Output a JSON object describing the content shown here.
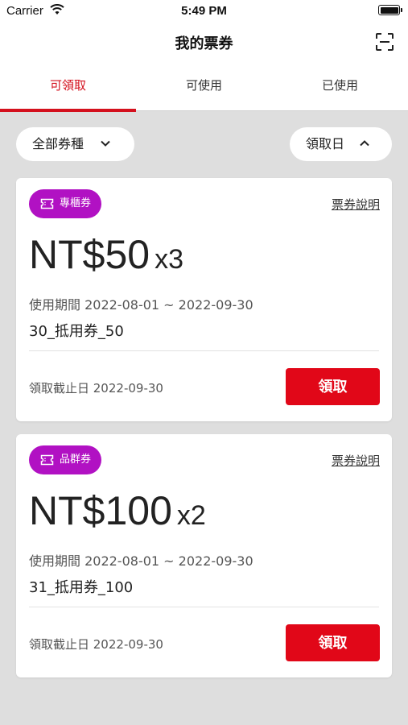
{
  "status_bar": {
    "carrier": "Carrier",
    "time": "5:49 PM"
  },
  "header": {
    "title": "我的票券"
  },
  "tabs": [
    {
      "label": "可領取",
      "active": true
    },
    {
      "label": "可使用",
      "active": false
    },
    {
      "label": "已使用",
      "active": false
    }
  ],
  "filters": {
    "type": "全部券種",
    "sort": "領取日"
  },
  "coupons": [
    {
      "badge": "專櫃券",
      "explain": "票券說明",
      "amount": "NT$50",
      "qty": "x3",
      "period": "使用期間 2022-08-01 ~ 2022-09-30",
      "name": "30_抵用券_50",
      "deadline": "領取截止日 2022-09-30",
      "claim": "領取"
    },
    {
      "badge": "品群券",
      "explain": "票券說明",
      "amount": "NT$100",
      "qty": "x2",
      "period": "使用期間 2022-08-01 ~ 2022-09-30",
      "name": "31_抵用券_100",
      "deadline": "領取截止日 2022-09-30",
      "claim": "領取"
    }
  ],
  "colors": {
    "accent": "#d4101d",
    "badge": "#b111c3",
    "button": "#e10718"
  }
}
